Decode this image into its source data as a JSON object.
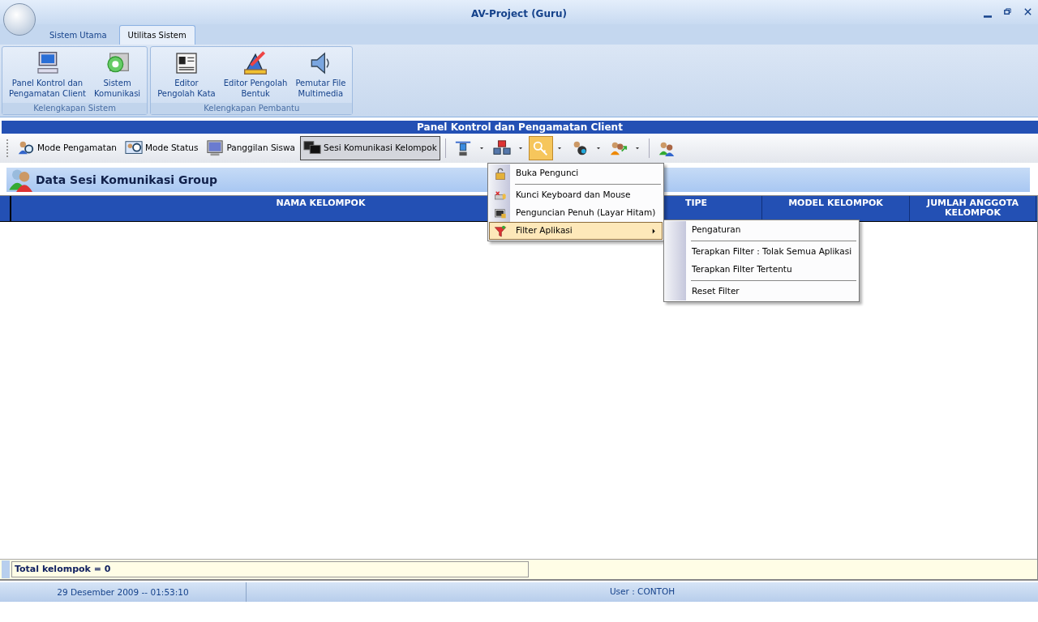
{
  "window": {
    "title": "AV-Project (Guru)"
  },
  "ribbon": {
    "tabs": [
      {
        "label": "Sistem Utama",
        "selected": false
      },
      {
        "label": "Utilitas Sistem",
        "selected": true
      }
    ],
    "groups": [
      {
        "title": "Kelengkapan Sistem",
        "buttons": [
          {
            "label": "Panel Kontrol dan\nPengamatan Client"
          },
          {
            "label": "Sistem\nKomunikasi"
          }
        ]
      },
      {
        "title": "Kelengkapan Pembantu",
        "buttons": [
          {
            "label": "Editor\nPengolah Kata"
          },
          {
            "label": "Editor Pengolah\nBentuk"
          },
          {
            "label": "Pemutar File\nMultimedia"
          }
        ]
      }
    ]
  },
  "panel": {
    "title": "Panel Kontrol dan Pengamatan Client",
    "toolbar": [
      {
        "kind": "text",
        "label": "Mode Pengamatan",
        "pressed": false
      },
      {
        "kind": "text",
        "label": "Mode Status",
        "pressed": false
      },
      {
        "kind": "text",
        "label": "Panggilan Siswa",
        "pressed": false
      },
      {
        "kind": "text",
        "label": "Sesi Komunikasi Kelompok",
        "pressed": true
      },
      {
        "kind": "separator"
      },
      {
        "kind": "dropdown",
        "pressed": false
      },
      {
        "kind": "dropdown",
        "pressed": false
      },
      {
        "kind": "dropdown",
        "pressed": true
      },
      {
        "kind": "dropdown",
        "pressed": false
      },
      {
        "kind": "dropdown",
        "pressed": false
      },
      {
        "kind": "separator"
      },
      {
        "kind": "icon",
        "pressed": false
      }
    ],
    "section_title": "Data Sesi Komunikasi Group",
    "table": {
      "columns": [
        "NAMA KELOMPOK",
        "TIPE",
        "MODEL KELOMPOK",
        "JUMLAH ANGGOTA KELOMPOK"
      ]
    },
    "footer": "Total kelompok = 0"
  },
  "menu": {
    "items": [
      {
        "kind": "item",
        "label": "Buka Pengunci",
        "selected": false
      },
      {
        "kind": "separator"
      },
      {
        "kind": "item",
        "label": "Kunci Keyboard dan Mouse",
        "selected": false
      },
      {
        "kind": "item",
        "label": "Penguncian Penuh (Layar Hitam)",
        "selected": false
      },
      {
        "kind": "submenu",
        "label": "Filter Aplikasi",
        "selected": true
      }
    ]
  },
  "submenu": {
    "items": [
      {
        "kind": "item",
        "label": "Pengaturan",
        "selected": false
      },
      {
        "kind": "separator"
      },
      {
        "kind": "item",
        "label": "Terapkan Filter : Tolak Semua Aplikasi",
        "selected": false
      },
      {
        "kind": "item",
        "label": "Terapkan Filter Tertentu",
        "selected": false
      },
      {
        "kind": "separator"
      },
      {
        "kind": "item",
        "label": "Reset Filter",
        "selected": false
      }
    ]
  },
  "status_bar": {
    "datetime": "29 Desember 2009 -- 01:53:10",
    "user": "User : CONTOH"
  }
}
